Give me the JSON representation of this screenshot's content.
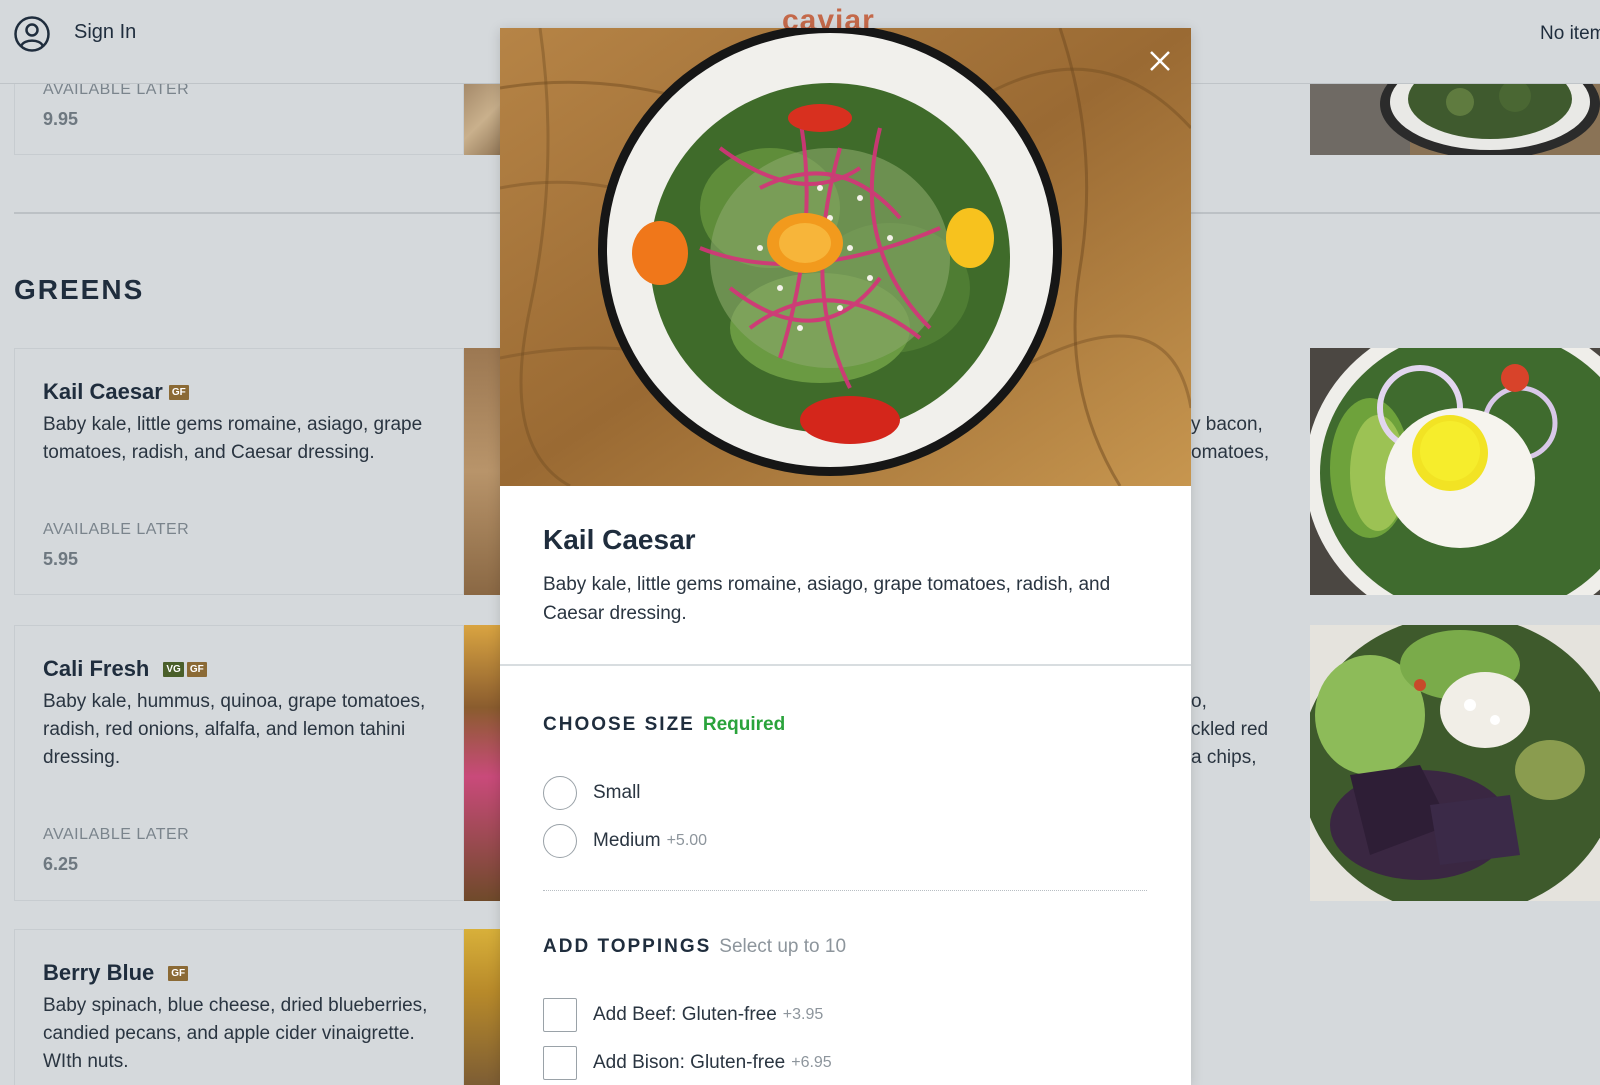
{
  "header": {
    "signin_label": "Sign In",
    "brand": "caviar",
    "cart_status": "No items"
  },
  "background": {
    "top_card": {
      "avail_label": "AVAILABLE LATER",
      "price": "9.95"
    },
    "section_title": "GREENS",
    "cards": [
      {
        "title": "Kail Caesar",
        "badges": [
          "GF"
        ],
        "desc": "Baby kale, little gems romaine, asiago, grape tomatoes, radish, and Caesar dressing.",
        "avail_label": "AVAILABLE LATER",
        "price": "5.95"
      },
      {
        "title": "Cali Fresh",
        "badges": [
          "VG",
          "GF"
        ],
        "desc": "Baby kale, hummus, quinoa, grape tomatoes, radish, red onions, alfalfa, and lemon tahini dressing.",
        "avail_label": "AVAILABLE LATER",
        "price": "6.25"
      },
      {
        "title": "Berry Blue",
        "badges": [
          "GF"
        ],
        "desc": "Baby spinach, blue cheese, dried blueberries, candied pecans, and apple cider vinaigrette. WIth nuts."
      }
    ],
    "right_partial_1": [
      "y bacon,",
      "omatoes,"
    ],
    "right_partial_2": [
      "o,",
      "ckled red",
      "a chips,"
    ]
  },
  "modal": {
    "title": "Kail Caesar",
    "desc": "Baby kale, little gems romaine, asiago, grape tomatoes, radish, and Caesar dressing.",
    "size_group": {
      "title": "CHOOSE SIZE",
      "hint": "Required",
      "options": [
        {
          "label": "Small",
          "price": ""
        },
        {
          "label": "Medium",
          "price": "+5.00"
        }
      ]
    },
    "toppings_group": {
      "title": "ADD TOPPINGS",
      "hint": "Select up to 10",
      "options": [
        {
          "label": "Add Beef: Gluten-free",
          "price": "+3.95"
        },
        {
          "label": "Add Bison: Gluten-free",
          "price": "+6.95"
        }
      ]
    }
  },
  "colors": {
    "brand": "#c4694a",
    "required_green": "#2aa33b",
    "badge_gf": "#8b6a35",
    "badge_vg": "#4a5f2a"
  }
}
